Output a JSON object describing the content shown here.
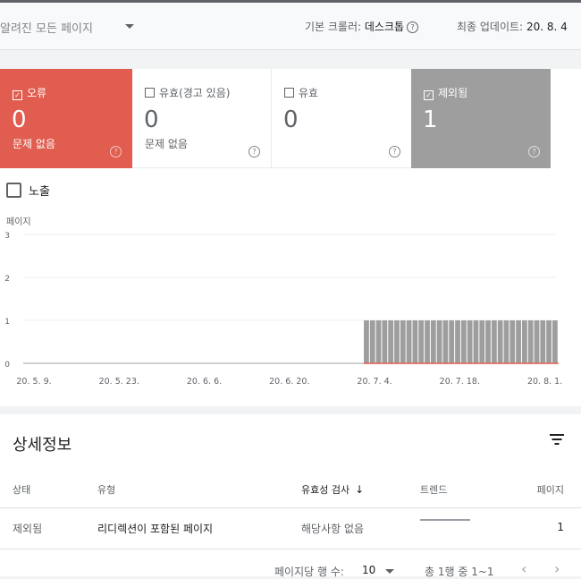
{
  "header": {
    "page_filter": "알려진 모든 페이지",
    "crawler_label": "기본 크롤러:",
    "crawler_value": "데스크톱",
    "updated_label": "최종 업데이트:",
    "updated_value": "20. 8. 4"
  },
  "tiles": [
    {
      "label": "오류",
      "checked": true,
      "value": "0",
      "sub": "문제 없음",
      "color": "#e05d4f"
    },
    {
      "label": "유효(경고 있음)",
      "checked": false,
      "value": "0",
      "sub": "문제 없음"
    },
    {
      "label": "유효",
      "checked": false,
      "value": "0",
      "sub": ""
    },
    {
      "label": "제외됨",
      "checked": true,
      "value": "1",
      "sub": "",
      "color": "#9e9e9e"
    }
  ],
  "impressions_label": "노출",
  "chart_data": {
    "type": "bar",
    "ylabel": "페이지",
    "ylim": [
      0,
      3
    ],
    "yticks": [
      "3",
      "2",
      "1",
      "0"
    ],
    "xtick_labels": [
      "20. 5. 9.",
      "20. 5. 23.",
      "20. 6. 6.",
      "20. 6. 20.",
      "20. 7. 4.",
      "20. 7. 18.",
      "20. 8. 1."
    ],
    "series": [
      {
        "name": "제외됨",
        "color": "#9e9e9e",
        "values_summary": "0 from 20. 5. 9. to 20. 7. 4.; 1 from 20. 7. 4. to 20. 8. 4.",
        "start_date": "2020-05-09",
        "end_date": "2020-08-04",
        "nonzero_from": "2020-07-04",
        "nonzero_value": 1
      },
      {
        "name": "오류",
        "color": "#e05d4f",
        "constant_value": 0
      }
    ]
  },
  "details": {
    "title": "상세정보",
    "columns": [
      "상태",
      "유형",
      "유효성 검사",
      "트렌드",
      "페이지"
    ],
    "rows": [
      {
        "status": "제외됨",
        "type": "리디렉션이 포함된 페이지",
        "validation": "해당사항 없음",
        "pages": "1"
      }
    ],
    "rows_per_page_label": "페이지당 행 수:",
    "rows_per_page": "10",
    "range_text": "총 1행 중 1~1"
  }
}
